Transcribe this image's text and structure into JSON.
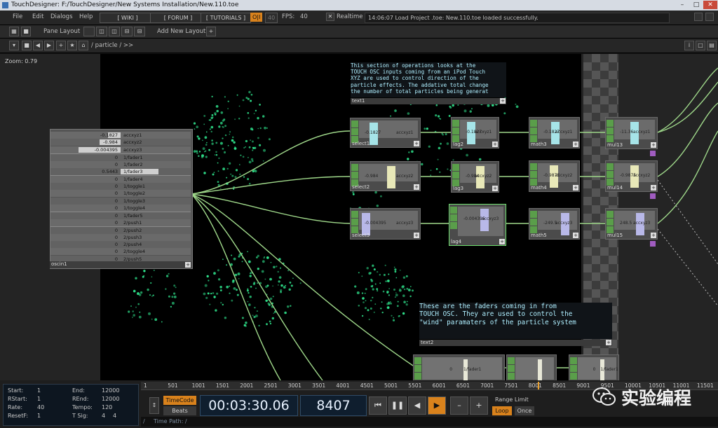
{
  "window": {
    "title": "TouchDesigner: F:/TouchDesigner/New Systems Installation/New.110.toe"
  },
  "menu": {
    "items": [
      "File",
      "Edit",
      "Dialogs",
      "Help"
    ],
    "wiki": "[ WIKI ]",
    "forum": "[ FORUM ]",
    "tutorials": "[ TUTORIALS ]",
    "oi": "O|I",
    "fps_label": "FPS:",
    "fps_value": "40",
    "realtime_label": "Realtime",
    "status_message": "14:06:07 Load Project .toe: New.110.toe loaded successfully."
  },
  "pane_bar": {
    "pane_layout": "Pane Layout",
    "add_new_layout": "Add New Layout"
  },
  "path_bar": {
    "path": "/ particle / >>"
  },
  "network": {
    "zoom": "Zoom: 0.79",
    "oscin": {
      "name": "oscin1",
      "rows": [
        {
          "v": "-0.1827",
          "n": "accxyz1",
          "f": 0.18
        },
        {
          "v": "-0.984",
          "n": "accxyz2",
          "f": 0.3
        },
        {
          "v": "-0.004395",
          "n": "accxyz3",
          "f": 0.6
        },
        {
          "v": "0",
          "n": "1/fader1",
          "f": 0
        },
        {
          "v": "0",
          "n": "1/fader2",
          "f": 0
        },
        {
          "v": "0.5443",
          "n": "1/fader3",
          "f": 0.54
        },
        {
          "v": "0",
          "n": "1/fader4",
          "f": 0
        },
        {
          "v": "0",
          "n": "1/toggle1",
          "f": 0
        },
        {
          "v": "0",
          "n": "1/toggle2",
          "f": 0
        },
        {
          "v": "0",
          "n": "1/toggle3",
          "f": 0
        },
        {
          "v": "0",
          "n": "1/toggle4",
          "f": 0
        },
        {
          "v": "0",
          "n": "1/fader5",
          "f": 0
        },
        {
          "v": "0",
          "n": "2/push1",
          "f": 0
        },
        {
          "v": "0",
          "n": "2/push2",
          "f": 0
        },
        {
          "v": "0",
          "n": "2/push3",
          "f": 0
        },
        {
          "v": "0",
          "n": "2/push4",
          "f": 0
        },
        {
          "v": "0",
          "n": "2/toggle4",
          "f": 0
        },
        {
          "v": "0",
          "n": "2/push5",
          "f": 0
        }
      ]
    },
    "nodes": [
      {
        "name": "select1",
        "val": "-0.1827",
        "ch": "accxyz1"
      },
      {
        "name": "select2",
        "val": "-0.984",
        "ch": "accxyz2"
      },
      {
        "name": "select3",
        "val": "-0.004395",
        "ch": "accxyz3"
      },
      {
        "name": "lag2",
        "val": "-0.1827",
        "ch": "accxyz1"
      },
      {
        "name": "lag3",
        "val": "-0.984",
        "ch": "accxyz2"
      },
      {
        "name": "lag4",
        "val": "-0.004395",
        "ch": "accxyz3"
      },
      {
        "name": "math3",
        "val": "-0.1827",
        "ch": "accxyz1"
      },
      {
        "name": "math4",
        "val": "-0.9875",
        "ch": "accxyz2"
      },
      {
        "name": "math5",
        "val": "-249.5",
        "ch": "accxyz3"
      },
      {
        "name": "mul13",
        "val": "-11.36",
        "ch": "accxyz1"
      },
      {
        "name": "mul14",
        "val": "-0.9875",
        "ch": "accxyz2"
      },
      {
        "name": "mul15",
        "val": "248.5",
        "ch": "accxyz3"
      }
    ],
    "text1": {
      "name": "text1",
      "body": "This section of operations looks at the\nTOUCH OSC inputs coming from an iPod Touch\nXYZ are used to control direction of the\nparticle effects. The addative total change\nthe number of total particles being generat"
    },
    "text2": {
      "name": "text2",
      "body": "These are the faders coming in from\nTOUCH OSC. They are used to control the\n\"wind\" paramaters of the particle system"
    },
    "fader_nodes": [
      {
        "val": "0",
        "ch": "1/fader1"
      },
      {
        "val": "",
        "ch": ""
      },
      {
        "val": "0",
        "ch": "1/fader1"
      }
    ]
  },
  "timeline": {
    "start_label": "Start:",
    "start": "1",
    "rstart_label": "RStart:",
    "rstart": "1",
    "rate_label": "Rate:",
    "rate": "40",
    "resetf_label": "ResetF:",
    "resetf": "1",
    "end_label": "End:",
    "end": "12000",
    "rend_label": "REnd:",
    "rend": "12000",
    "tempo_label": "Tempo:",
    "tempo": "120",
    "tsig_label": "T Sig:",
    "tsig_a": "4",
    "tsig_b": "4",
    "ruler": [
      "1",
      "501",
      "1001",
      "1501",
      "2001",
      "2501",
      "3001",
      "3501",
      "4001",
      "4501",
      "5001",
      "5501",
      "6001",
      "6501",
      "7001",
      "7501",
      "8001",
      "8501",
      "9001",
      "9501",
      "10001",
      "10501",
      "11001",
      "11501"
    ],
    "timecode_btn": "TimeCode",
    "beats_btn": "Beats",
    "timecode": "00:03:30.06",
    "frame": "8407",
    "range_limit": "Range Limit",
    "loop": "Loop",
    "once": "Once",
    "time_path": "Time Path: /"
  },
  "watermark": {
    "text": "实验编程"
  },
  "colors": {
    "accent": "#d9821c",
    "note_text": "#aeeefe",
    "node_flag": "#5a9e4a",
    "wire": "#9fd88a",
    "particle": "#2ee08a"
  }
}
